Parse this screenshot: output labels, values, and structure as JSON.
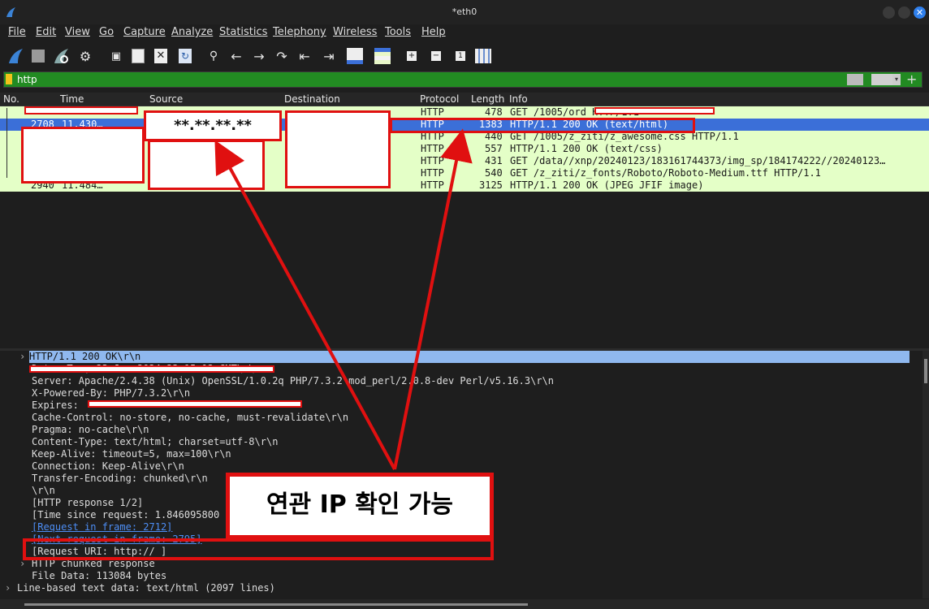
{
  "window": {
    "title": "*eth0"
  },
  "menu": [
    "File",
    "Edit",
    "View",
    "Go",
    "Capture",
    "Analyze",
    "Statistics",
    "Telephony",
    "Wireless",
    "Tools",
    "Help"
  ],
  "filter": {
    "value": "http"
  },
  "columns": {
    "no": "No.",
    "time": "Time",
    "source": "Source",
    "destination": "Destination",
    "protocol": "Protocol",
    "length": "Length",
    "info": "Info"
  },
  "packets": [
    {
      "protocol": "HTTP",
      "length": "478",
      "info": "GET /1005/ord                        HTTP/1.1"
    },
    {
      "no": "2708",
      "time": "11.430…",
      "protocol": "HTTP",
      "length": "1383",
      "info": "HTTP/1.1 200 OK  (text/html)"
    },
    {
      "protocol": "HTTP",
      "length": "440",
      "info": "GET /1005/z_ziti/z_awesome.css HTTP/1.1"
    },
    {
      "protocol": "HTTP",
      "length": "557",
      "info": "HTTP/1.1 200 OK  (text/css)"
    },
    {
      "protocol": "HTTP",
      "length": "431",
      "info": "GET /data//xnp/20240123/183161744373/img_sp/184174222//20240123…"
    },
    {
      "protocol": "HTTP",
      "length": "540",
      "info": "GET /z_ziti/z_fonts/Roboto/Roboto-Medium.ttf HTTP/1.1"
    },
    {
      "no": "2940",
      "time": "11.484…",
      "protocol": "HTTP",
      "length": "3125",
      "info": "HTTP/1.1 200 OK  (JPEG JFIF image)"
    }
  ],
  "masked_ip": "**.**.**.**",
  "details": {
    "status_line": "HTTP/1.1 200 OK\\r\\n",
    "date_line": "Date: Tue, 23 Jan 2024 23:15:12 GMT\\r\\n",
    "server": "Server: Apache/2.4.38 (Unix) OpenSSL/1.0.2q PHP/7.3.2 mod_perl/2.0.8-dev Perl/v5.16.3\\r\\n",
    "powered_by": "X-Powered-By: PHP/7.3.2\\r\\n",
    "expires": "Expires: ",
    "cache_control": "Cache-Control: no-store, no-cache, must-revalidate\\r\\n",
    "pragma": "Pragma: no-cache\\r\\n",
    "content_type": "Content-Type: text/html; charset=utf-8\\r\\n",
    "keep_alive": "Keep-Alive: timeout=5, max=100\\r\\n",
    "connection": "Connection: Keep-Alive\\r\\n",
    "transfer_encoding": "Transfer-Encoding: chunked\\r\\n",
    "crlf": "\\r\\n",
    "http_response": "[HTTP response 1/2]",
    "time_since": "[Time since request: 1.846095800 seconds]",
    "request_in_frame": "[Request in frame: 2712]",
    "next_request": "[Next request in frame: 2795]",
    "request_uri": "[Request URI: http://                                                   ]",
    "chunked": "HTTP chunked response",
    "file_data": "File Data: 113084 bytes",
    "line_based": "Line-based text data: text/html (2097 lines)"
  },
  "callout": "연관 IP 확인 가능"
}
